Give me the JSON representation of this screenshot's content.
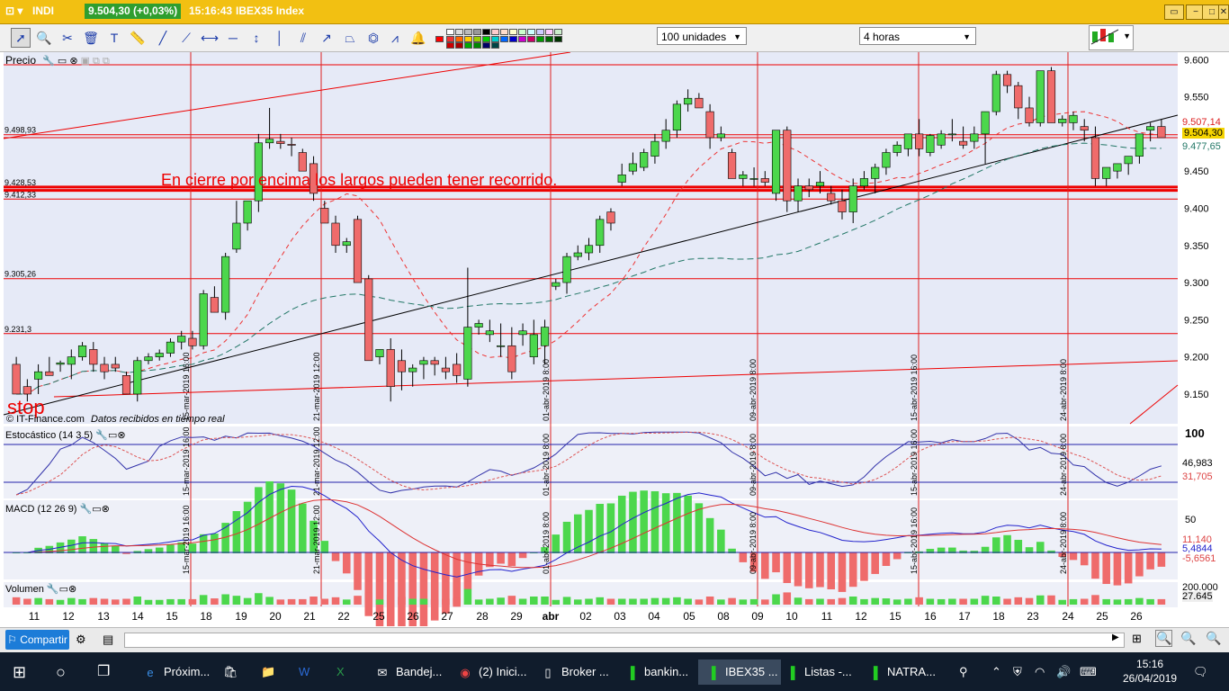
{
  "titlebar": {
    "symbol": "INDI",
    "price_change": "9.504,30 (+0,03%)",
    "time": "15:16:43",
    "instrument": "IBEX35 Index",
    "win_restore": "▭",
    "win_min": "−",
    "win_max": "□",
    "win_close": "✕"
  },
  "toolbar": {
    "units_select": "100 unidades",
    "period_select": "4 horas"
  },
  "chart": {
    "y_ticks": [
      "9.600",
      "9.550",
      "9.500",
      "9.450",
      "9.400",
      "9.350",
      "9.300",
      "9.250",
      "9.200",
      "9.150"
    ],
    "right_labels": {
      "r1": "9.507,14",
      "r2": "9.504,30",
      "r3": "9.477,65"
    },
    "left_levels": [
      "9.498,93",
      "9.428,53",
      "9.412,33",
      "9.305,26",
      "9.231,3"
    ],
    "annotation": "En cierre por encima los largos pueden tener recorrido.",
    "stop": "stop",
    "source": "© IT-Finance.com",
    "source_note": "Datos recibidos en tiempo real",
    "price_title": "Precio",
    "vlines": [
      "15-mar-2019 16:00",
      "21-mar-2019 12:00",
      "01-abr-2019 8:00",
      "09-abr-2019 8:00",
      "15-abr-2019 16:00",
      "24-abr-2019 8:00"
    ],
    "stoch": {
      "title": "Estocástico (14 3 5)",
      "top": "100",
      "v1": "46,983",
      "v2": "31,705"
    },
    "macd": {
      "title": "MACD (12 26 9)",
      "top": "50",
      "v1": "11,140",
      "v2": "5,4844",
      "v3": "-5,6561"
    },
    "volume": {
      "title": "Volumen",
      "top": "200.000",
      "v1": "27.645"
    },
    "x_labels": [
      "11",
      "12",
      "13",
      "14",
      "15",
      "18",
      "19",
      "20",
      "21",
      "22",
      "25",
      "26",
      "27",
      "28",
      "29",
      "abr",
      "02",
      "03",
      "04",
      "05",
      "08",
      "09",
      "10",
      "11",
      "12",
      "15",
      "16",
      "17",
      "18",
      "23",
      "24",
      "25",
      "26"
    ]
  },
  "chart_data": {
    "type": "candlestick",
    "title": "IBEX35 Index",
    "period": "4 horas",
    "ylim": [
      9110,
      9610
    ],
    "candles": [
      [
        9190,
        9200,
        9150,
        9150
      ],
      [
        9160,
        9170,
        9140,
        9150
      ],
      [
        9170,
        9190,
        9150,
        9180
      ],
      [
        9180,
        9200,
        9175,
        9175
      ],
      [
        9190,
        9195,
        9180,
        9192
      ],
      [
        9190,
        9210,
        9170,
        9200
      ],
      [
        9200,
        9220,
        9195,
        9215
      ],
      [
        9210,
        9220,
        9180,
        9190
      ],
      [
        9190,
        9200,
        9170,
        9180
      ],
      [
        9190,
        9200,
        9180,
        9185
      ],
      [
        9175,
        9180,
        9150,
        9150
      ],
      [
        9150,
        9200,
        9140,
        9195
      ],
      [
        9195,
        9205,
        9190,
        9200
      ],
      [
        9200,
        9210,
        9195,
        9205
      ],
      [
        9205,
        9225,
        9200,
        9220
      ],
      [
        9220,
        9235,
        9210,
        9228
      ],
      [
        9225,
        9235,
        9210,
        9215
      ],
      [
        9215,
        9290,
        9210,
        9285
      ],
      [
        9280,
        9295,
        9260,
        9260
      ],
      [
        9260,
        9340,
        9250,
        9335
      ],
      [
        9345,
        9410,
        9340,
        9380
      ],
      [
        9380,
        9410,
        9370,
        9410
      ],
      [
        9410,
        9500,
        9395,
        9488
      ],
      [
        9488,
        9535,
        9480,
        9493
      ],
      [
        9490,
        9500,
        9480,
        9487
      ],
      [
        9486,
        9495,
        9470,
        9485
      ],
      [
        9475,
        9480,
        9455,
        9450
      ],
      [
        9460,
        9470,
        9410,
        9420
      ],
      [
        9400,
        9410,
        9380,
        9380
      ],
      [
        9380,
        9390,
        9340,
        9350
      ],
      [
        9350,
        9360,
        9340,
        9355
      ],
      [
        9385,
        9390,
        9320,
        9300
      ],
      [
        9305,
        9310,
        9200,
        9195
      ],
      [
        9200,
        9210,
        9190,
        9210
      ],
      [
        9210,
        9225,
        9140,
        9160
      ],
      [
        9195,
        9210,
        9155,
        9180
      ],
      [
        9180,
        9190,
        9160,
        9185
      ],
      [
        9190,
        9200,
        9170,
        9195
      ],
      [
        9195,
        9200,
        9175,
        9190
      ],
      [
        9185,
        9200,
        9170,
        9180
      ],
      [
        9190,
        9205,
        9165,
        9175
      ],
      [
        9170,
        9320,
        9160,
        9240
      ],
      [
        9240,
        9250,
        9230,
        9245
      ],
      [
        9230,
        9250,
        9220,
        9235
      ],
      [
        9215,
        9245,
        9200,
        9215
      ],
      [
        9215,
        9240,
        9170,
        9180
      ],
      [
        9230,
        9245,
        9215,
        9235
      ],
      [
        9200,
        9250,
        9190,
        9230
      ],
      [
        9215,
        9250,
        9190,
        9240
      ],
      [
        9295,
        9305,
        9290,
        9300
      ],
      [
        9300,
        9340,
        9285,
        9335
      ],
      [
        9335,
        9350,
        9330,
        9340
      ],
      [
        9340,
        9360,
        9330,
        9350
      ],
      [
        9350,
        9390,
        9340,
        9385
      ],
      [
        9395,
        9400,
        9370,
        9380
      ],
      [
        9435,
        9460,
        9430,
        9445
      ],
      [
        9450,
        9475,
        9445,
        9460
      ],
      [
        9455,
        9480,
        9450,
        9475
      ],
      [
        9470,
        9500,
        9460,
        9490
      ],
      [
        9490,
        9520,
        9480,
        9505
      ],
      [
        9505,
        9545,
        9495,
        9540
      ],
      [
        9540,
        9560,
        9530,
        9548
      ],
      [
        9548,
        9555,
        9535,
        9535
      ],
      [
        9530,
        9540,
        9480,
        9495
      ],
      [
        9495,
        9510,
        9490,
        9500
      ],
      [
        9475,
        9480,
        9440,
        9440
      ],
      [
        9440,
        9450,
        9430,
        9445
      ],
      [
        9440,
        9455,
        9430,
        9440
      ],
      [
        9440,
        9450,
        9430,
        9435
      ],
      [
        9420,
        9500,
        9410,
        9505
      ],
      [
        9505,
        9510,
        9395,
        9410
      ],
      [
        9410,
        9440,
        9395,
        9430
      ],
      [
        9430,
        9440,
        9415,
        9425
      ],
      [
        9430,
        9450,
        9420,
        9435
      ],
      [
        9420,
        9430,
        9405,
        9410
      ],
      [
        9410,
        9425,
        9385,
        9395
      ],
      [
        9395,
        9440,
        9380,
        9430
      ],
      [
        9430,
        9450,
        9425,
        9440
      ],
      [
        9440,
        9460,
        9420,
        9455
      ],
      [
        9455,
        9480,
        9445,
        9475
      ],
      [
        9475,
        9490,
        9470,
        9485
      ],
      [
        9480,
        9500,
        9470,
        9500
      ],
      [
        9500,
        9520,
        9470,
        9480
      ],
      [
        9475,
        9500,
        9470,
        9498
      ],
      [
        9485,
        9505,
        9480,
        9500
      ],
      [
        9500,
        9520,
        9490,
        9500
      ],
      [
        9490,
        9510,
        9480,
        9485
      ],
      [
        9490,
        9510,
        9480,
        9500
      ],
      [
        9500,
        9530,
        9460,
        9530
      ],
      [
        9530,
        9585,
        9525,
        9580
      ],
      [
        9580,
        9585,
        9555,
        9565
      ],
      [
        9565,
        9570,
        9520,
        9535
      ],
      [
        9535,
        9550,
        9510,
        9515
      ],
      [
        9515,
        9585,
        9510,
        9585
      ],
      [
        9585,
        9590,
        9515,
        9515
      ],
      [
        9515,
        9525,
        9510,
        9520
      ],
      [
        9515,
        9530,
        9505,
        9525
      ],
      [
        9510,
        9520,
        9490,
        9505
      ],
      [
        9495,
        9510,
        9430,
        9440
      ],
      [
        9440,
        9455,
        9430,
        9455
      ],
      [
        9450,
        9460,
        9440,
        9460
      ],
      [
        9460,
        9470,
        9445,
        9470
      ],
      [
        9470,
        9500,
        9460,
        9500
      ],
      [
        9505,
        9515,
        9490,
        9510
      ],
      [
        9510,
        9520,
        9495,
        9495
      ]
    ],
    "levels": [
      9593,
      9498.93,
      9495,
      9428.53,
      9424,
      9412.33,
      9305.26,
      9231.3
    ]
  }
}
